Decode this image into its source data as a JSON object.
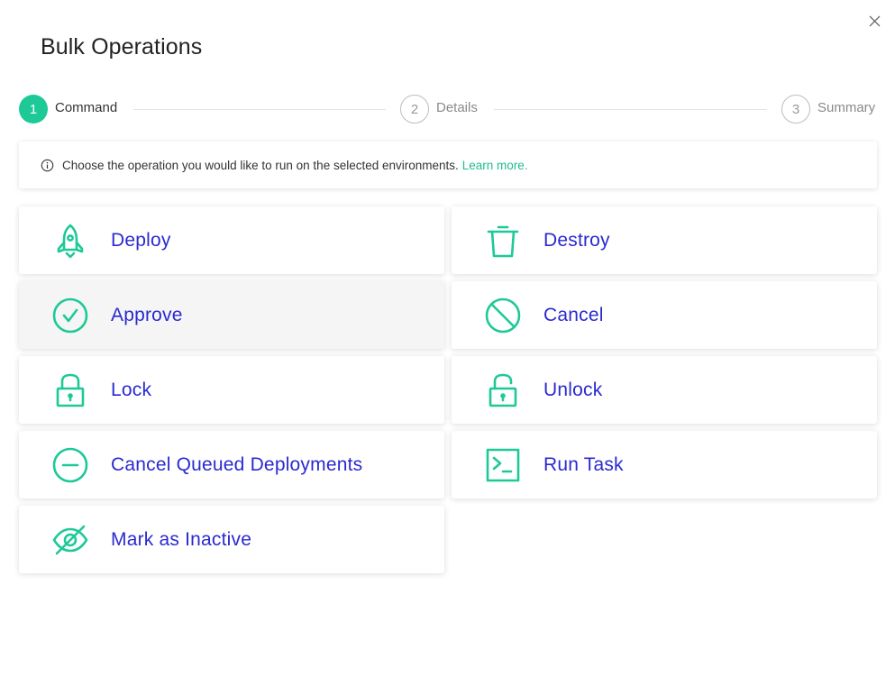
{
  "modal": {
    "title": "Bulk Operations",
    "close_label": "X"
  },
  "stepper": {
    "steps": [
      {
        "number": "1",
        "label": "Command",
        "state": "active"
      },
      {
        "number": "2",
        "label": "Details",
        "state": "pending"
      },
      {
        "number": "3",
        "label": "Summary",
        "state": "pending"
      }
    ]
  },
  "info": {
    "icon": "info-circle-icon",
    "text": "Choose the operation you would like to run on the selected environments.",
    "link_text": "Learn more."
  },
  "operations": [
    {
      "label": "Deploy",
      "icon": "rocket-icon"
    },
    {
      "label": "Destroy",
      "icon": "trash-icon"
    },
    {
      "label": "Approve",
      "icon": "check-circle-icon"
    },
    {
      "label": "Cancel",
      "icon": "prohibited-icon"
    },
    {
      "label": "Lock",
      "icon": "lock-icon"
    },
    {
      "label": "Unlock",
      "icon": "unlock-icon"
    },
    {
      "label": "Cancel Queued Deployments",
      "icon": "minus-circle-icon"
    },
    {
      "label": "Run Task",
      "icon": "terminal-icon"
    },
    {
      "label": "Mark as Inactive",
      "icon": "eye-off-icon"
    }
  ],
  "colors": {
    "accent": "#1dc997",
    "link": "#1dbd8f",
    "operation_label": "#2a2ad0",
    "hover_background": "#f5f5f5"
  }
}
